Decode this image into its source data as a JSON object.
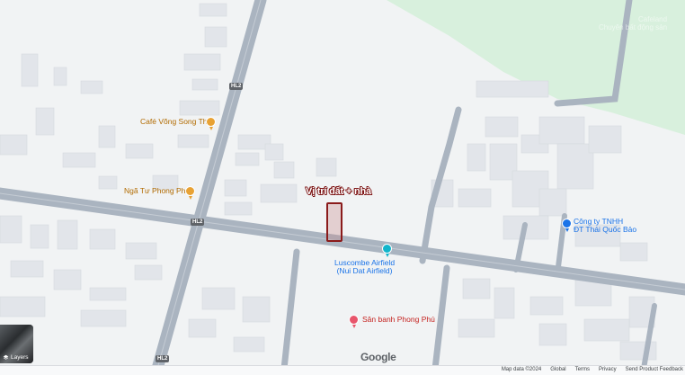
{
  "map": {
    "annotation": "Vị trí đất + nhà",
    "pois": {
      "cafe": "Café Võng Song Thy",
      "nga_tu": "Ngã Tư Phong Phú",
      "airfield_line1": "Luscombe Airfield",
      "airfield_line2": "(Nui Dat Airfield)",
      "company_line1": "Công ty TNHH",
      "company_line2": "ĐT Thái Quốc Bảo",
      "san_banh": "Sân banh Phong Phú"
    },
    "road_shields": {
      "top": "HL2",
      "middle": "HL2",
      "bottom": "HL2"
    },
    "watermark_line1": "Cafeland",
    "watermark_line2": "Chuyên bất động sản",
    "logo": "Google"
  },
  "layers_button": {
    "label": "Layers",
    "icon": "layers-icon"
  },
  "footer": {
    "map_data": "Map data ©2024",
    "global": "Global",
    "terms": "Terms",
    "privacy": "Privacy",
    "send_feedback": "Send Product Feedback"
  },
  "colors": {
    "land": "#f1f3f4",
    "road": "#aab4c0",
    "building": "#e2e5ea",
    "park": "#d8f0dd",
    "marker": "#8a1b1b",
    "poi_orange": "#e8a234",
    "poi_blue": "#1a73e8",
    "poi_pink": "#e8556b"
  }
}
